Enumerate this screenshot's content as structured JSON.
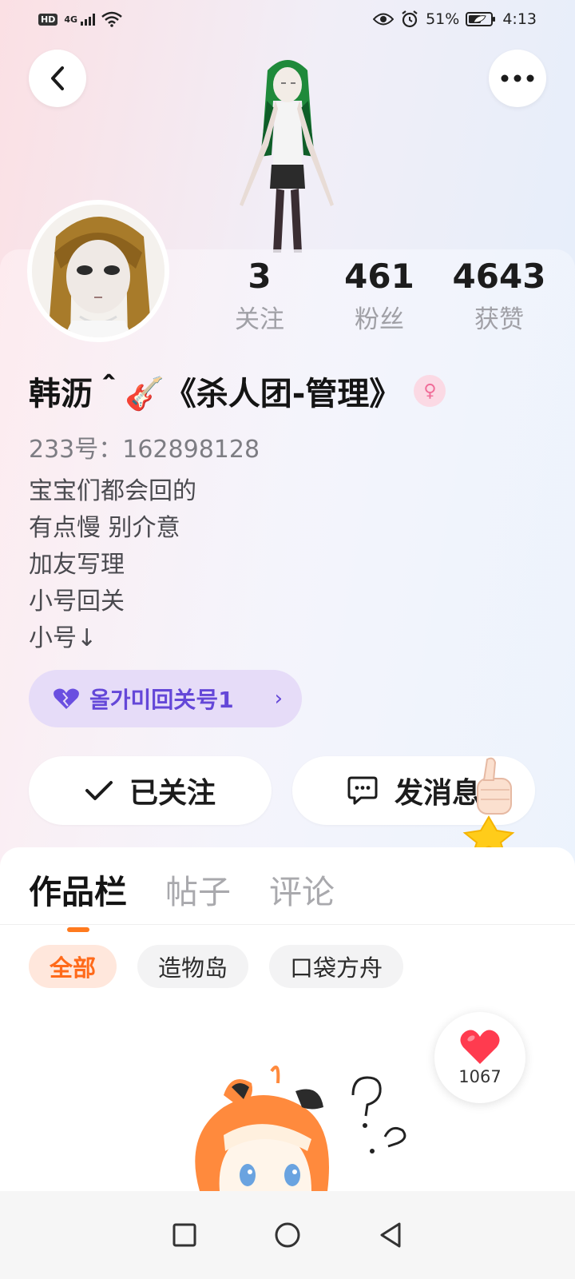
{
  "status_bar": {
    "hd_badge": "HD",
    "network": "4G",
    "battery_percent": "51%",
    "time": "4:13",
    "icons": [
      "signal-icon",
      "wifi-icon",
      "eye-icon",
      "alarm-icon",
      "battery-icon"
    ]
  },
  "header": {
    "back_icon": "chevron-left-icon",
    "more_icon": "more-dots-icon"
  },
  "stats": [
    {
      "value": "3",
      "label": "关注"
    },
    {
      "value": "461",
      "label": "粉丝"
    },
    {
      "value": "4643",
      "label": "获赞"
    }
  ],
  "profile": {
    "nickname": "韩沥＾🎸《杀人团-管理》",
    "gender_symbol": "♀",
    "uid": "233号：162898128",
    "bio_lines": [
      "宝宝们都会回的",
      "有点慢 别介意",
      "加友写理",
      "小号回关",
      "小号↓"
    ]
  },
  "linked_tag": {
    "icon": "purple-heart-icon",
    "label": "올가미回关号1",
    "chevron": "›"
  },
  "actions": {
    "follow_label": "已关注",
    "message_label": "发消息"
  },
  "tabs": [
    "作品栏",
    "帖子",
    "评论"
  ],
  "active_tab_index": 0,
  "filters": [
    "全部",
    "造物岛",
    "口袋方舟"
  ],
  "active_filter_index": 0,
  "like_float": {
    "count": "1067"
  },
  "colors": {
    "accent_orange": "#ff7a1e",
    "tag_purple": "#6447d8",
    "heart_red": "#ff3b4f"
  }
}
